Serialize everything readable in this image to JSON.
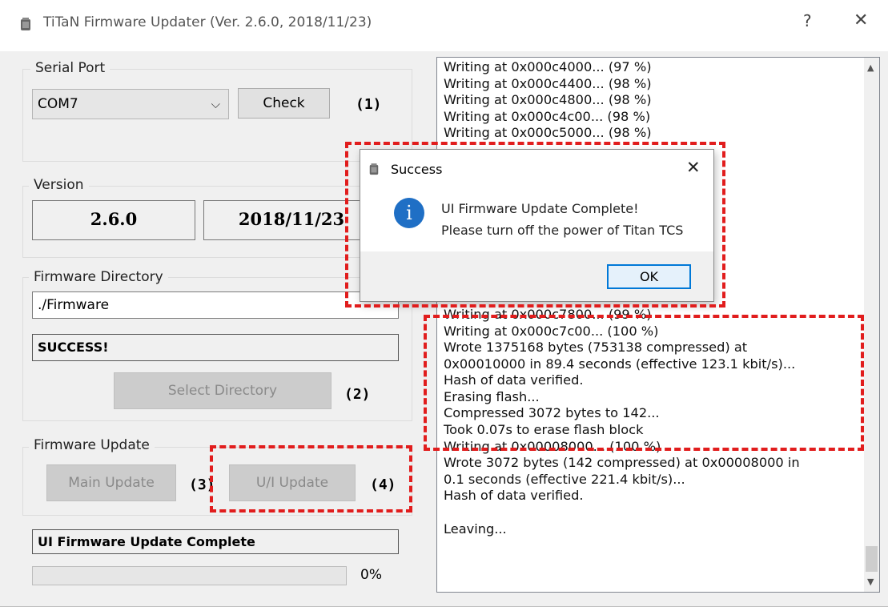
{
  "window": {
    "title": "TiTaN Firmware Updater (Ver. 2.6.0, 2018/11/23)",
    "help_label": "?",
    "close_label": "✕"
  },
  "serial_port": {
    "group_label": "Serial Port",
    "selected": "COM7",
    "check_label": "Check",
    "step": "(1)"
  },
  "version": {
    "group_label": "Version",
    "number": "2.6.0",
    "date": "2018/11/23"
  },
  "firmware_directory": {
    "group_label": "Firmware Directory",
    "path": "./Firmware",
    "status": "SUCCESS!",
    "select_label": "Select Directory",
    "step": "(2)"
  },
  "firmware_update": {
    "group_label": "Firmware Update",
    "main_label": "Main Update",
    "main_step": "(3)",
    "ui_label": "U/I Update",
    "ui_step": "(4)",
    "status": "UI Firmware Update Complete",
    "progress_percent": 0,
    "progress_text": "0%"
  },
  "log": {
    "lines": [
      "Writing at 0x000c4000... (97 %)",
      "Writing at 0x000c4400... (98 %)",
      "Writing at 0x000c4800... (98 %)",
      "Writing at 0x000c4c00... (98 %)",
      "Writing at 0x000c5000... (98 %)",
      "",
      "",
      "",
      "",
      "",
      "",
      "",
      "",
      "",
      "",
      "Writing at 0x000c7800... (99 %)",
      "Writing at 0x000c7c00... (100 %)",
      "Wrote 1375168 bytes (753138 compressed) at",
      "0x00010000 in 89.4 seconds (effective 123.1 kbit/s)...",
      "Hash of data verified.",
      "Erasing flash...",
      "Compressed 3072 bytes to 142...",
      "Took 0.07s to erase flash block",
      "Writing at 0x00008000... (100 %)",
      "Wrote 3072 bytes (142 compressed) at 0x00008000 in",
      "0.1 seconds (effective 221.4 kbit/s)...",
      "Hash of data verified.",
      "",
      "Leaving..."
    ]
  },
  "dialog": {
    "title": "Success",
    "close_label": "✕",
    "icon": "info-icon",
    "icon_glyph": "i",
    "message_line1": "UI Firmware Update Complete!",
    "message_line2": "Please turn off the power of Titan TCS",
    "ok_label": "OK"
  },
  "colors": {
    "annotation": "#e11d1d",
    "dialog_accent": "#0078d7",
    "info_icon": "#1f6fc5"
  }
}
